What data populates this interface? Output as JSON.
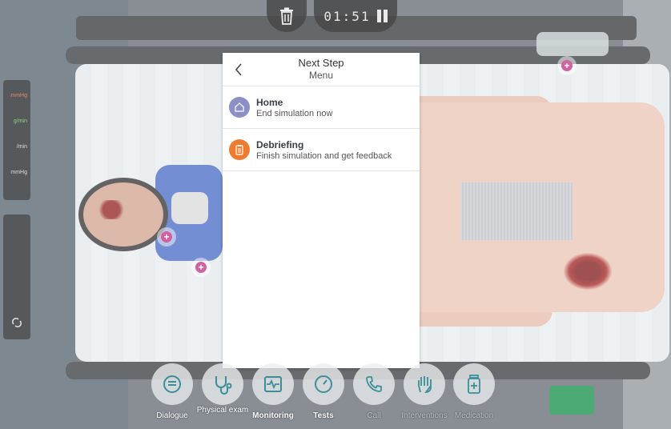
{
  "timer": {
    "value": "01:51"
  },
  "monitor": {
    "labels": [
      "mmHg",
      "g/min",
      "/min",
      "mmHg"
    ]
  },
  "modal": {
    "title": "Next Step",
    "subtitle": "Menu",
    "items": [
      {
        "title": "Home",
        "subtitle": "End simulation now",
        "icon": "home-icon"
      },
      {
        "title": "Debriefing",
        "subtitle": "Finish simulation and get feedback",
        "icon": "clipboard-icon"
      }
    ]
  },
  "toolbar": {
    "items": [
      {
        "label": "Dialogue",
        "icon": "speech-bubble-icon"
      },
      {
        "label": "Physical exam",
        "icon": "stethoscope-icon"
      },
      {
        "label": "Monitoring",
        "icon": "heart-monitor-icon"
      },
      {
        "label": "Tests",
        "icon": "gauge-icon"
      },
      {
        "label": "Call",
        "icon": "phone-icon"
      },
      {
        "label": "Interventions",
        "icon": "hand-icon"
      },
      {
        "label": "Medication",
        "icon": "medicine-bottle-icon"
      }
    ]
  },
  "colors": {
    "home_icon_bg": "#8c90c4",
    "debrief_icon_bg": "#ef7b2f",
    "hotspot": "#c0267a",
    "toolbar_icon": "#3a8f9a"
  }
}
